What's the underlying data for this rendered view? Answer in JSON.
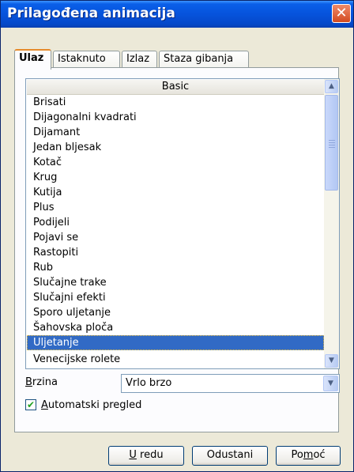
{
  "window": {
    "title": "Prilagođena animacija",
    "close_glyph": "✕"
  },
  "tabs": [
    {
      "label": "Ulaz",
      "active": true
    },
    {
      "label": "Istaknuto",
      "active": false
    },
    {
      "label": "Izlaz",
      "active": false
    },
    {
      "label": "Staza gibanja",
      "active": false
    }
  ],
  "effects_list": {
    "group_header": "Basic",
    "items": [
      "Brisati",
      "Dijagonalni kvadrati",
      "Dijamant",
      "Jedan bljesak",
      "Kotač",
      "Krug",
      "Kutija",
      "Plus",
      "Podijeli",
      "Pojavi se",
      "Rastopiti",
      "Rub",
      "Slučajne trake",
      "Slučajni efekti",
      "Sporo uljetanje",
      "Šahovska ploča",
      "Uljetanje",
      "Venecijske rolete"
    ],
    "selected": "Uljetanje",
    "scroll_up_icon": "▲",
    "scroll_down_icon": "▼"
  },
  "speed": {
    "label_underlined": "B",
    "label_rest": "rzina",
    "value": "Vrlo brzo",
    "dropdown_icon": "▼"
  },
  "preview": {
    "checked": true,
    "check_glyph": "✔",
    "label_underlined": "A",
    "label_rest": "utomatski pregled"
  },
  "buttons": {
    "ok": {
      "label_underlined": "U",
      "label_rest": " redu"
    },
    "cancel": {
      "label": "Odustani"
    },
    "help": {
      "label_pre": "Po",
      "label_underlined": "m",
      "label_post": "oć"
    }
  },
  "colors": {
    "selection": "#316ac5",
    "titlebar": "#0653dc",
    "tab_highlight": "#e68b2c"
  }
}
